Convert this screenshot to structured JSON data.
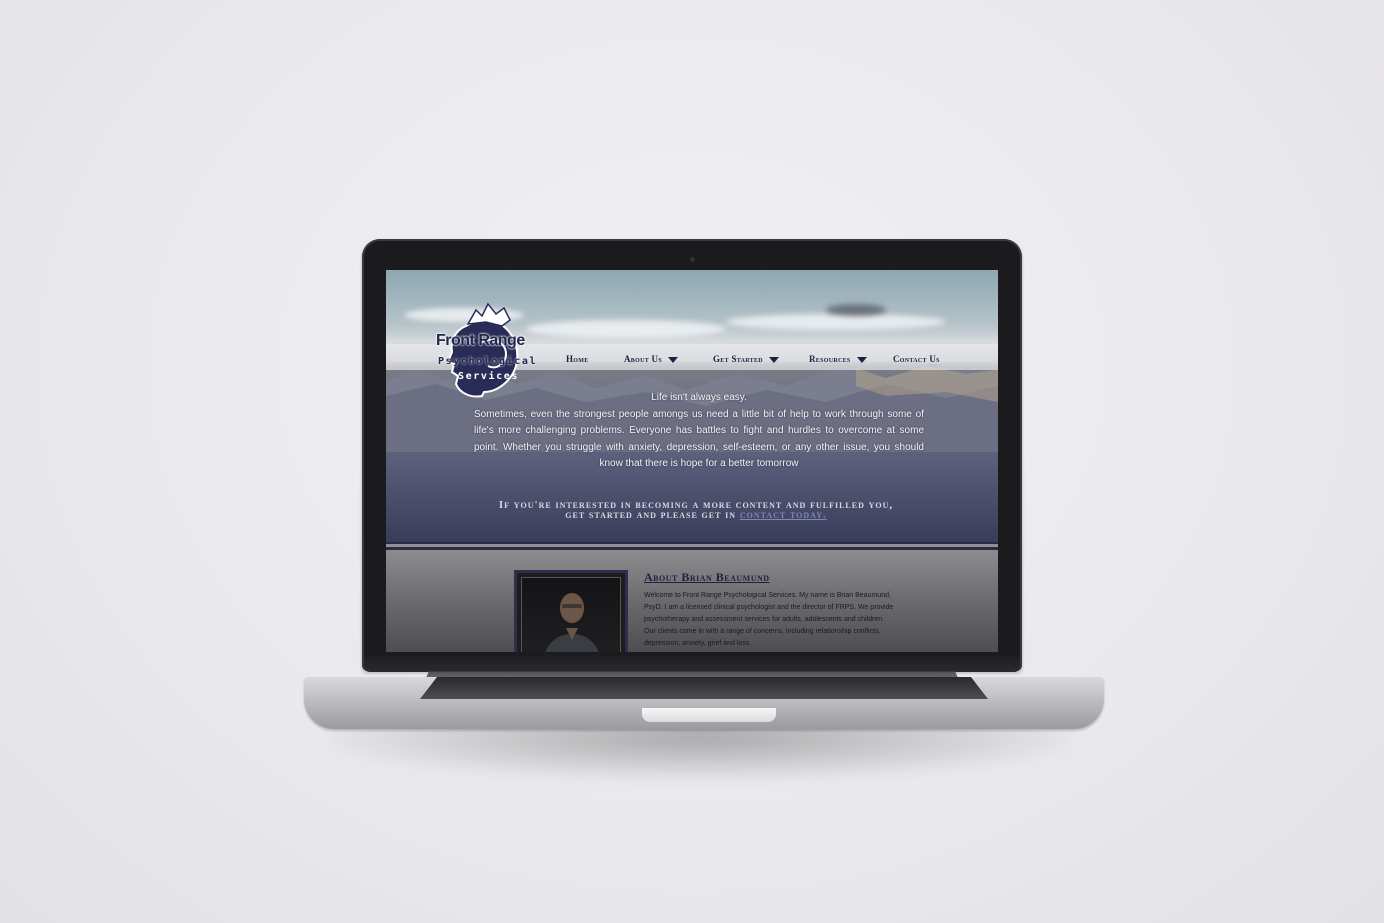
{
  "site": {
    "logo": {
      "line1": "Front Range",
      "line2": "Psychological",
      "line3": "Services"
    },
    "nav": [
      {
        "label": "Home",
        "has_dropdown": false
      },
      {
        "label": "About Us",
        "has_dropdown": true
      },
      {
        "label": "Get Started",
        "has_dropdown": true
      },
      {
        "label": "Resources",
        "has_dropdown": true
      },
      {
        "label": "Contact Us",
        "has_dropdown": false
      }
    ],
    "hero": {
      "headline": "Life isn't always easy.",
      "body": "Sometimes, even the strongest people amongs us need a little bit of help to work through some of life's more challenging problems. Everyone has battles to fight and hurdles to overcome at some point. Whether you struggle with anxiety, depression, self-esteem, or any other issue, you should know that there is hope for a better tomorrow",
      "cta_line1": "If you're interested in becoming a more content and fulfilled you,",
      "cta_line2_prefix": "get started and please get in ",
      "cta_link": "contact today."
    },
    "about": {
      "title": "About Brian Beaumund",
      "text": "Welcome to Front Range Psychological Services.  My name is Brian Beaumund, PsyD. I am a licensed clinical psychologist and the director of FRPS. We provide psychotherapy and assessment services for adults, adolescents and children. Our clients come in with a range of concerns, including relationship conflicts, depression, anxiety, grief and loss."
    }
  },
  "colors": {
    "navy": "#24264f",
    "link": "#7f86b8",
    "background": "#ebeaed"
  }
}
